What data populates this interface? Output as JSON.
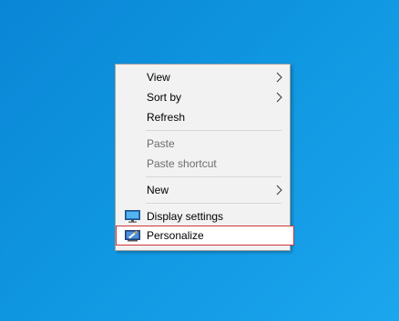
{
  "desktop": {
    "background_color": "#0f96e0"
  },
  "context_menu": {
    "items": [
      {
        "label": "View",
        "has_submenu": true,
        "enabled": true
      },
      {
        "label": "Sort by",
        "has_submenu": true,
        "enabled": true
      },
      {
        "label": "Refresh",
        "has_submenu": false,
        "enabled": true
      },
      {
        "label": "Paste",
        "has_submenu": false,
        "enabled": false
      },
      {
        "label": "Paste shortcut",
        "has_submenu": false,
        "enabled": false
      },
      {
        "label": "New",
        "has_submenu": true,
        "enabled": true
      },
      {
        "label": "Display settings",
        "icon": "display-icon",
        "enabled": true
      },
      {
        "label": "Personalize",
        "icon": "personalize-icon",
        "enabled": true,
        "highlighted": true
      }
    ],
    "highlight_color": "#d13438"
  }
}
